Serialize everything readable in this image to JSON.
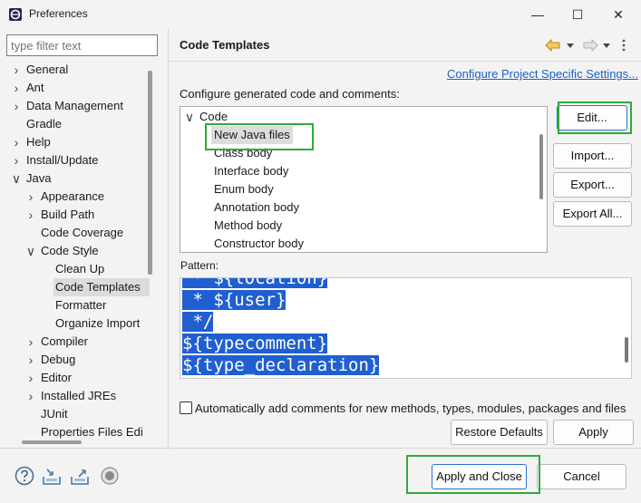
{
  "window": {
    "title": "Preferences",
    "min_glyph": "—",
    "max_glyph": "☐",
    "close_glyph": "✕"
  },
  "filter": {
    "placeholder": "type filter text"
  },
  "tree": [
    {
      "label": "General",
      "expander": ">"
    },
    {
      "label": "Ant",
      "expander": ">"
    },
    {
      "label": "Data Management",
      "expander": ">"
    },
    {
      "label": "Gradle",
      "expander": ""
    },
    {
      "label": "Help",
      "expander": ">"
    },
    {
      "label": "Install/Update",
      "expander": ">"
    },
    {
      "label": "Java",
      "expander": "v"
    },
    {
      "label": "Appearance",
      "expander": ">"
    },
    {
      "label": "Build Path",
      "expander": ">"
    },
    {
      "label": "Code Coverage",
      "expander": ""
    },
    {
      "label": "Code Style",
      "expander": "v"
    },
    {
      "label": "Clean Up",
      "expander": ""
    },
    {
      "label": "Code Templates",
      "expander": "",
      "selected": true
    },
    {
      "label": "Formatter",
      "expander": ""
    },
    {
      "label": "Organize Import",
      "expander": ""
    },
    {
      "label": "Compiler",
      "expander": ">"
    },
    {
      "label": "Debug",
      "expander": ">"
    },
    {
      "label": "Editor",
      "expander": ">"
    },
    {
      "label": "Installed JREs",
      "expander": ">"
    },
    {
      "label": "JUnit",
      "expander": ""
    },
    {
      "label": "Properties Files Edi",
      "expander": ""
    }
  ],
  "page": {
    "title": "Code Templates",
    "configure_link": "Configure Project Specific Settings...",
    "generated_label": "Configure generated code and comments:",
    "pattern_label": "Pattern:",
    "checkbox_label": "Automatically add comments for new methods, types, modules, packages and files",
    "checkbox_checked": false
  },
  "templates": [
    {
      "label": "Code",
      "expander": "v"
    },
    {
      "label": "New Java files",
      "selected": true
    },
    {
      "label": "Class body"
    },
    {
      "label": "Interface body"
    },
    {
      "label": "Enum body"
    },
    {
      "label": "Annotation body"
    },
    {
      "label": "Method body"
    },
    {
      "label": "Constructor body"
    }
  ],
  "buttons": {
    "edit": "Edit...",
    "import": "Import...",
    "export": "Export...",
    "export_all": "Export All...",
    "restore_defaults": "Restore Defaults",
    "apply": "Apply",
    "apply_and_close": "Apply and Close",
    "cancel": "Cancel"
  },
  "pattern_lines": [
    " * ${location}",
    " * ${user}",
    " */",
    "${typecomment}",
    "${type_declaration}"
  ],
  "colors": {
    "highlight": "#1f5fd1",
    "link": "#1a62c8",
    "annotation_box": "#2eaa3a"
  },
  "footer_icons": [
    "help-icon",
    "import-prefs-icon",
    "export-prefs-icon",
    "record-icon"
  ]
}
